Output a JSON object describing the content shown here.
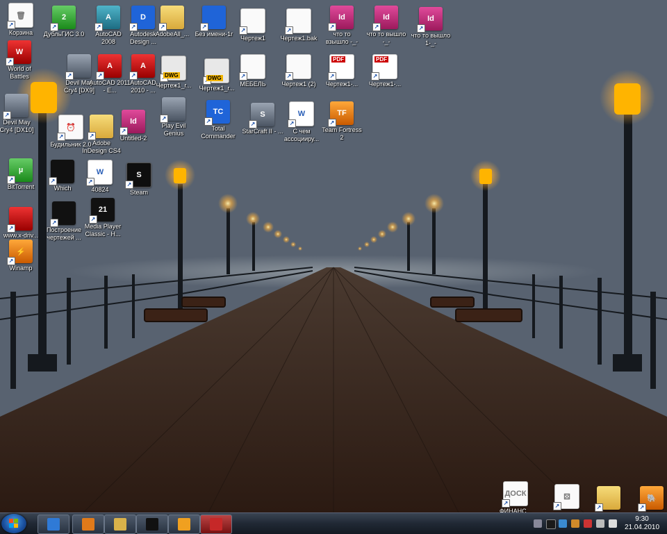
{
  "desktop": {
    "icons": [
      {
        "label": "Корзина",
        "badge": "🗑",
        "style": "g-file"
      },
      {
        "label": "ДубльГИС 3.0",
        "badge": "2",
        "style": "g-green"
      },
      {
        "label": "AutoCAD 2008",
        "badge": "A",
        "style": "g-teal"
      },
      {
        "label": "Autodesk Design ...",
        "badge": "D",
        "style": "g-blue"
      },
      {
        "label": "AdobeAll_...",
        "badge": "",
        "style": "g-folder"
      },
      {
        "label": "Без имени-1г",
        "badge": "",
        "style": "g-blue"
      },
      {
        "label": "Чертеж1",
        "badge": "",
        "style": "g-file"
      },
      {
        "label": "Чертеж1.bak",
        "badge": "",
        "style": "g-file"
      },
      {
        "label": "что то взышло -_-",
        "badge": "Id",
        "style": "g-id"
      },
      {
        "label": "что то вышло -_-",
        "badge": "Id",
        "style": "g-id"
      },
      {
        "label": "что то вышло 1-_-",
        "badge": "Id",
        "style": "g-id"
      },
      {
        "label": "World of Battles",
        "badge": "W",
        "style": "g-red"
      },
      {
        "label": "Devil May Cry4 [DX9]",
        "badge": "",
        "style": "g-person"
      },
      {
        "label": "AutoCAD 2011 - E...",
        "badge": "A",
        "style": "g-red"
      },
      {
        "label": "AutoCAD 2010 - ...",
        "badge": "A",
        "style": "g-red"
      },
      {
        "label": "Чертеж1_r...",
        "badge": "",
        "style": "g-dwg"
      },
      {
        "label": "Чертеж1_r...",
        "badge": "",
        "style": "g-dwg"
      },
      {
        "label": "МЕБЕЛЬ",
        "badge": "",
        "style": "g-file"
      },
      {
        "label": "Чертеж1 (2)",
        "badge": "",
        "style": "g-file"
      },
      {
        "label": "Чертеж1-...",
        "badge": "",
        "style": "g-pdf"
      },
      {
        "label": "Чертеж1-...",
        "badge": "",
        "style": "g-pdf"
      },
      {
        "label": "Devil May Cry4 [DX10]",
        "badge": "",
        "style": "g-person"
      },
      {
        "label": "Будильник 2.0",
        "badge": "⏰",
        "style": "g-file"
      },
      {
        "label": "Adobe InDesign CS4",
        "badge": "",
        "style": "g-folder"
      },
      {
        "label": "Untitled-2",
        "badge": "Id",
        "style": "g-id"
      },
      {
        "label": "Play Evil Genius",
        "badge": "",
        "style": "g-person"
      },
      {
        "label": "Total Commander",
        "badge": "TC",
        "style": "g-blue"
      },
      {
        "label": "StarCraft II - ...",
        "badge": "S",
        "style": "g-person"
      },
      {
        "label": "С чем ассоцииру...",
        "badge": "W",
        "style": "g-word"
      },
      {
        "label": "Team Fortress 2",
        "badge": "TF",
        "style": "g-orange"
      },
      {
        "label": "BitTorrent",
        "badge": "µ",
        "style": "g-green"
      },
      {
        "label": "Which",
        "badge": "",
        "style": "g-dark"
      },
      {
        "label": "40824",
        "badge": "W",
        "style": "g-word"
      },
      {
        "label": "Steam",
        "badge": "S",
        "style": "g-steam"
      },
      {
        "label": "www.x-driv...",
        "badge": "",
        "style": "g-red"
      },
      {
        "label": "Построение чертежей ...",
        "badge": "",
        "style": "g-dark"
      },
      {
        "label": "Media Player Classic - H...",
        "badge": "21",
        "style": "g-dark"
      },
      {
        "label": "Winamp",
        "badge": "⚡",
        "style": "g-orange"
      },
      {
        "label": "ФИНАНС...",
        "badge": "ДОСК",
        "style": "g-file"
      },
      {
        "label": "",
        "badge": "⚄",
        "style": "g-file"
      },
      {
        "label": "",
        "badge": "",
        "style": "g-folder"
      },
      {
        "label": "",
        "badge": "🐘",
        "style": "g-orange"
      }
    ]
  },
  "taskbar": {
    "pinned": [
      {
        "name": "internet-explorer",
        "color": "#2f7ad6"
      },
      {
        "name": "media-player",
        "color": "#e07a1a"
      },
      {
        "name": "explorer",
        "color": "#d9b24a"
      },
      {
        "name": "steam",
        "color": "#111111"
      },
      {
        "name": "winamp",
        "color": "#f0a020"
      },
      {
        "name": "autocad",
        "color": "#c62828"
      }
    ],
    "clock": {
      "time": "9:30",
      "date": "21.04.2010"
    }
  },
  "colors": {
    "accent": "#1a4f9e",
    "label_text": "#ffffff"
  }
}
